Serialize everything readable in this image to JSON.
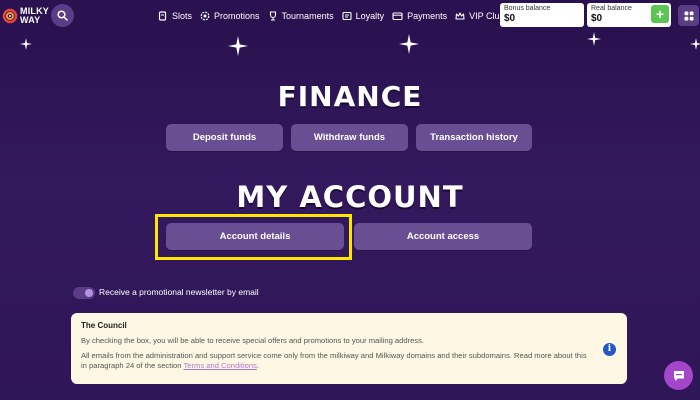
{
  "header": {
    "logo_line1": "MILKY",
    "logo_line2": "WAY",
    "nav": [
      {
        "label": "Slots",
        "icon": "slot-machine-icon"
      },
      {
        "label": "Promotions",
        "icon": "gear-badge-icon"
      },
      {
        "label": "Tournaments",
        "icon": "trophy-icon"
      },
      {
        "label": "Loyalty",
        "icon": "loyalty-card-icon"
      },
      {
        "label": "Payments",
        "icon": "wallet-icon"
      },
      {
        "label": "VIP Club",
        "icon": "crown-icon"
      }
    ],
    "bonus_balance_label": "Bonus balance",
    "bonus_balance_value": "$0",
    "real_balance_label": "Real balance",
    "real_balance_value": "$0",
    "add_funds_label": "+"
  },
  "finance": {
    "title": "FINANCE",
    "buttons": [
      "Deposit funds",
      "Withdraw funds",
      "Transaction history"
    ]
  },
  "account": {
    "title": "MY ACCOUNT",
    "buttons": [
      "Account details",
      "Account access"
    ]
  },
  "newsletter": {
    "label": "Receive a promotional newsletter by email",
    "enabled": true
  },
  "notice": {
    "title": "The Council",
    "paragraph1": "By checking the box, you will be able to receive special offers and promotions to your mailing address.",
    "paragraph2": "All emails from the administration and support service come only from the milkiway and Milkiway domains and their subdomains. Read more about this in paragraph 24 of the section",
    "link": "Terms and Conditions",
    "trailing": "."
  },
  "colors": {
    "background": "#2e1654",
    "button": "#6a4e94",
    "highlight": "#ffe600",
    "add_button": "#5cc455",
    "chat_button": "#a346c9"
  }
}
